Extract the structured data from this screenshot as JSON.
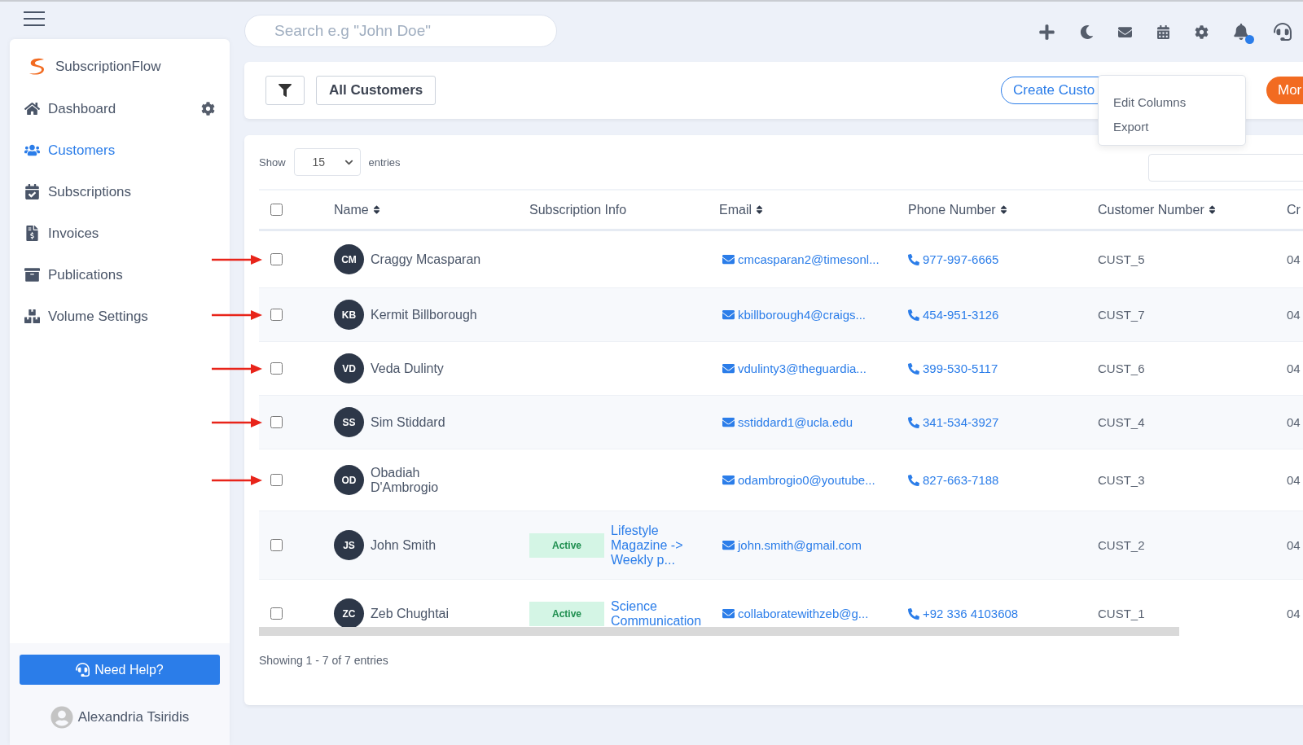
{
  "header": {
    "search": {
      "placeholder": "Search e.g \"John Doe\""
    },
    "notification_dot": true
  },
  "sidebar": {
    "brand": "SubscriptionFlow",
    "items": [
      {
        "label": "Dashboard",
        "selected": false
      },
      {
        "label": "Customers",
        "selected": true
      },
      {
        "label": "Subscriptions",
        "selected": false
      },
      {
        "label": "Invoices",
        "selected": false
      },
      {
        "label": "Publications",
        "selected": false
      },
      {
        "label": "Volume Settings",
        "selected": false
      }
    ],
    "help_button": "Need Help?",
    "user": "Alexandria Tsiridis"
  },
  "toolbar": {
    "view_button": "All Customers",
    "create_button": "Create Custo",
    "more_button": "Mor",
    "menu": {
      "items": [
        "Edit Columns",
        "Export"
      ]
    }
  },
  "table": {
    "show_label": "Show",
    "page_size": "15",
    "entries_label": "entries",
    "columns": [
      {
        "label": "Name",
        "sortable": true
      },
      {
        "label": "Subscription Info",
        "sortable": false
      },
      {
        "label": "Email",
        "sortable": true
      },
      {
        "label": "Phone Number",
        "sortable": true
      },
      {
        "label": "Customer Number",
        "sortable": true
      },
      {
        "label": "Cr",
        "sortable": false
      }
    ],
    "select_all": {
      "checked": false
    },
    "rows": [
      {
        "initials": "CM",
        "name": "Craggy Mcasparan",
        "email": "cmcasparan2@timesonl...",
        "phone": "977-997-6665",
        "customer_number": "CUST_5",
        "column_6": "04",
        "checked": false,
        "arrow": true
      },
      {
        "initials": "KB",
        "name": "Kermit Billborough",
        "email": "kbillborough4@craigs...",
        "phone": "454-951-3126",
        "customer_number": "CUST_7",
        "column_6": "04",
        "checked": false,
        "arrow": true
      },
      {
        "initials": "VD",
        "name": "Veda Dulinty",
        "email": "vdulinty3@theguardia...",
        "phone": "399-530-5117",
        "customer_number": "CUST_6",
        "column_6": "04",
        "checked": false,
        "arrow": true
      },
      {
        "initials": "SS",
        "name": "Sim Stiddard",
        "email": "sstiddard1@ucla.edu",
        "phone": "341-534-3927",
        "customer_number": "CUST_4",
        "column_6": "04",
        "checked": false,
        "arrow": true
      },
      {
        "initials": "OD",
        "name": "Obadiah D'Ambrogio",
        "email": "odambrogio0@youtube...",
        "phone": "827-663-7188",
        "customer_number": "CUST_3",
        "column_6": "04",
        "checked": false,
        "arrow": true
      },
      {
        "initials": "JS",
        "name": "John Smith",
        "subscription": {
          "status": "Active",
          "plan": "Lifestyle Magazine -> Weekly p..."
        },
        "email": "john.smith@gmail.com",
        "customer_number": "CUST_2",
        "column_6": "04",
        "checked": false,
        "arrow": false
      },
      {
        "initials": "ZC",
        "name": "Zeb Chughtai",
        "subscription": {
          "status": "Active",
          "plan": "Science Communication"
        },
        "email": "collaboratewithzeb@g...",
        "phone": "+92 336 4103608",
        "customer_number": "CUST_1",
        "column_6": "04",
        "checked": false,
        "arrow": false
      }
    ],
    "footer": "Showing 1 - 7 of 7 entries"
  }
}
